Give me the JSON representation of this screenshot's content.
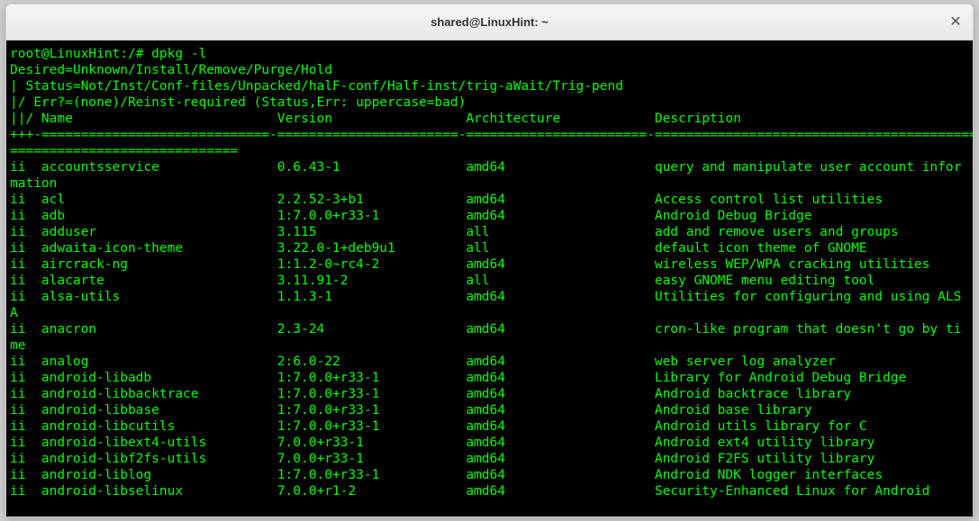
{
  "window": {
    "title": "shared@LinuxHint: ~",
    "close_icon": "✕"
  },
  "terminal": {
    "prompt": "root@LinuxHint:/# dpkg -l",
    "header": [
      "Desired=Unknown/Install/Remove/Purge/Hold",
      "| Status=Not/Inst/Conf-files/Unpacked/halF-conf/Half-inst/trig-aWait/Trig-pend",
      "|/ Err?=(none)/Reinst-required (Status,Err: uppercase=bad)",
      "||/ Name                          Version                 Architecture            Description",
      "+++-=============================-=======================-=======================-================================================================",
      "============================="
    ],
    "packages": [
      {
        "status": "ii",
        "name": "accountsservice",
        "version": "0.6.43-1",
        "arch": "amd64",
        "desc": "query and manipulate user account infor",
        "wrap": "mation"
      },
      {
        "status": "ii",
        "name": "acl",
        "version": "2.2.52-3+b1",
        "arch": "amd64",
        "desc": "Access control list utilities"
      },
      {
        "status": "ii",
        "name": "adb",
        "version": "1:7.0.0+r33-1",
        "arch": "amd64",
        "desc": "Android Debug Bridge"
      },
      {
        "status": "ii",
        "name": "adduser",
        "version": "3.115",
        "arch": "all",
        "desc": "add and remove users and groups"
      },
      {
        "status": "ii",
        "name": "adwaita-icon-theme",
        "version": "3.22.0-1+deb9u1",
        "arch": "all",
        "desc": "default icon theme of GNOME"
      },
      {
        "status": "ii",
        "name": "aircrack-ng",
        "version": "1:1.2-0~rc4-2",
        "arch": "amd64",
        "desc": "wireless WEP/WPA cracking utilities"
      },
      {
        "status": "ii",
        "name": "alacarte",
        "version": "3.11.91-2",
        "arch": "all",
        "desc": "easy GNOME menu editing tool"
      },
      {
        "status": "ii",
        "name": "alsa-utils",
        "version": "1.1.3-1",
        "arch": "amd64",
        "desc": "Utilities for configuring and using ALS",
        "wrap": "A"
      },
      {
        "status": "ii",
        "name": "anacron",
        "version": "2.3-24",
        "arch": "amd64",
        "desc": "cron-like program that doesn't go by ti",
        "wrap": "me"
      },
      {
        "status": "ii",
        "name": "analog",
        "version": "2:6.0-22",
        "arch": "amd64",
        "desc": "web server log analyzer"
      },
      {
        "status": "ii",
        "name": "android-libadb",
        "version": "1:7.0.0+r33-1",
        "arch": "amd64",
        "desc": "Library for Android Debug Bridge"
      },
      {
        "status": "ii",
        "name": "android-libbacktrace",
        "version": "1:7.0.0+r33-1",
        "arch": "amd64",
        "desc": "Android backtrace library"
      },
      {
        "status": "ii",
        "name": "android-libbase",
        "version": "1:7.0.0+r33-1",
        "arch": "amd64",
        "desc": "Android base library"
      },
      {
        "status": "ii",
        "name": "android-libcutils",
        "version": "1:7.0.0+r33-1",
        "arch": "amd64",
        "desc": "Android utils library for C"
      },
      {
        "status": "ii",
        "name": "android-libext4-utils",
        "version": "7.0.0+r33-1",
        "arch": "amd64",
        "desc": "Android ext4 utility library"
      },
      {
        "status": "ii",
        "name": "android-libf2fs-utils",
        "version": "7.0.0+r33-1",
        "arch": "amd64",
        "desc": "Android F2FS utility library"
      },
      {
        "status": "ii",
        "name": "android-liblog",
        "version": "1:7.0.0+r33-1",
        "arch": "amd64",
        "desc": "Android NDK logger interfaces"
      },
      {
        "status": "ii",
        "name": "android-libselinux",
        "version": "7.0.0+r1-2",
        "arch": "amd64",
        "desc": "Security-Enhanced Linux for Android"
      }
    ],
    "columns": {
      "status": 4,
      "name": 30,
      "version": 24,
      "arch": 24
    }
  }
}
